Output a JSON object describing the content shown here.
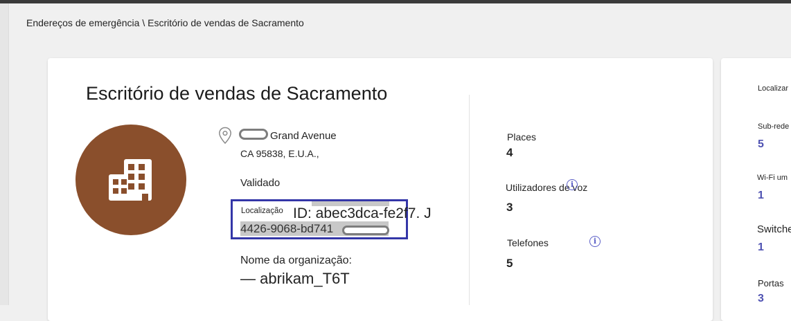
{
  "breadcrumb": "Endereços de emergência \\ Escritório de vendas de Sacramento",
  "location": {
    "title": "Escritório de vendas de Sacramento",
    "icon": "building-icon",
    "avatar_color": "#8a4f2c",
    "address_line1": "Grand Avenue",
    "address_line2": "CA 95838, E.U.A.,",
    "status": "Validado",
    "location_id_label": "Localização",
    "location_id_part1": "ID: abec3dca-fe2f7. J",
    "location_id_part2": "4426-9068-bd741",
    "highlight_color": "#3436a8",
    "org_label": "Nome da organização:",
    "org_value": "— abrikam_T6T"
  },
  "stats": {
    "places_label": "Places",
    "places_value": "4",
    "voice_users_label": "Utilizadores de voz",
    "voice_users_value": "3",
    "phones_label": "Telefones",
    "phones_value": "5"
  },
  "side_panel": {
    "localizar_label": "Localizar",
    "subnet_label": "Sub-rede",
    "subnet_value": "5",
    "wifi_label": "Wi-Fi um",
    "wifi_value": "1",
    "switches_label": "Switche",
    "switches_value": "1",
    "ports_label": "Portas",
    "ports_value": "3",
    "accent_color": "#4f52b2"
  }
}
